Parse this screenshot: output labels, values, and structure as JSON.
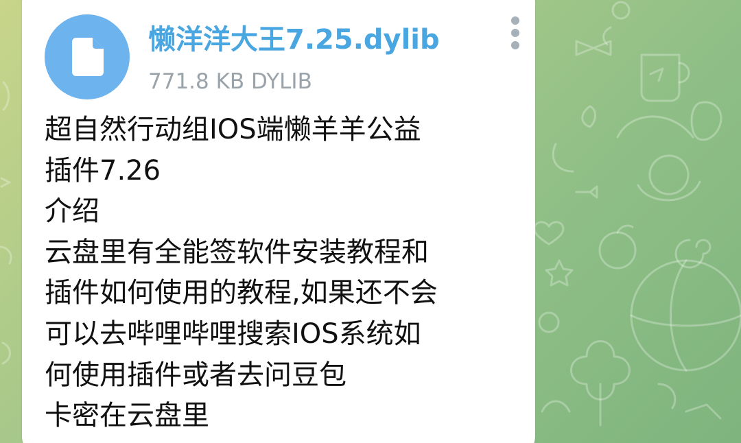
{
  "file": {
    "name": "懒洋洋大王7.25.dylib",
    "meta": "771.8 KB DYLIB",
    "icon": "document-icon"
  },
  "message": {
    "lines": [
      "超自然行动组IOS端懒羊羊公益",
      "插件7.26",
      "介绍",
      "云盘里有全能签软件安装教程和",
      "插件如何使用的教程,如果还不会",
      "可以去哔哩哔哩搜索IOS系统如",
      "何使用插件或者去问豆包",
      "卡密在云盘里"
    ]
  },
  "colors": {
    "accent": "#4aa6e0",
    "file_icon_bg": "#6db3ed",
    "meta_text": "#9aa3aa",
    "bubble_bg": "#ffffff",
    "wallpaper": "#9cc487"
  }
}
